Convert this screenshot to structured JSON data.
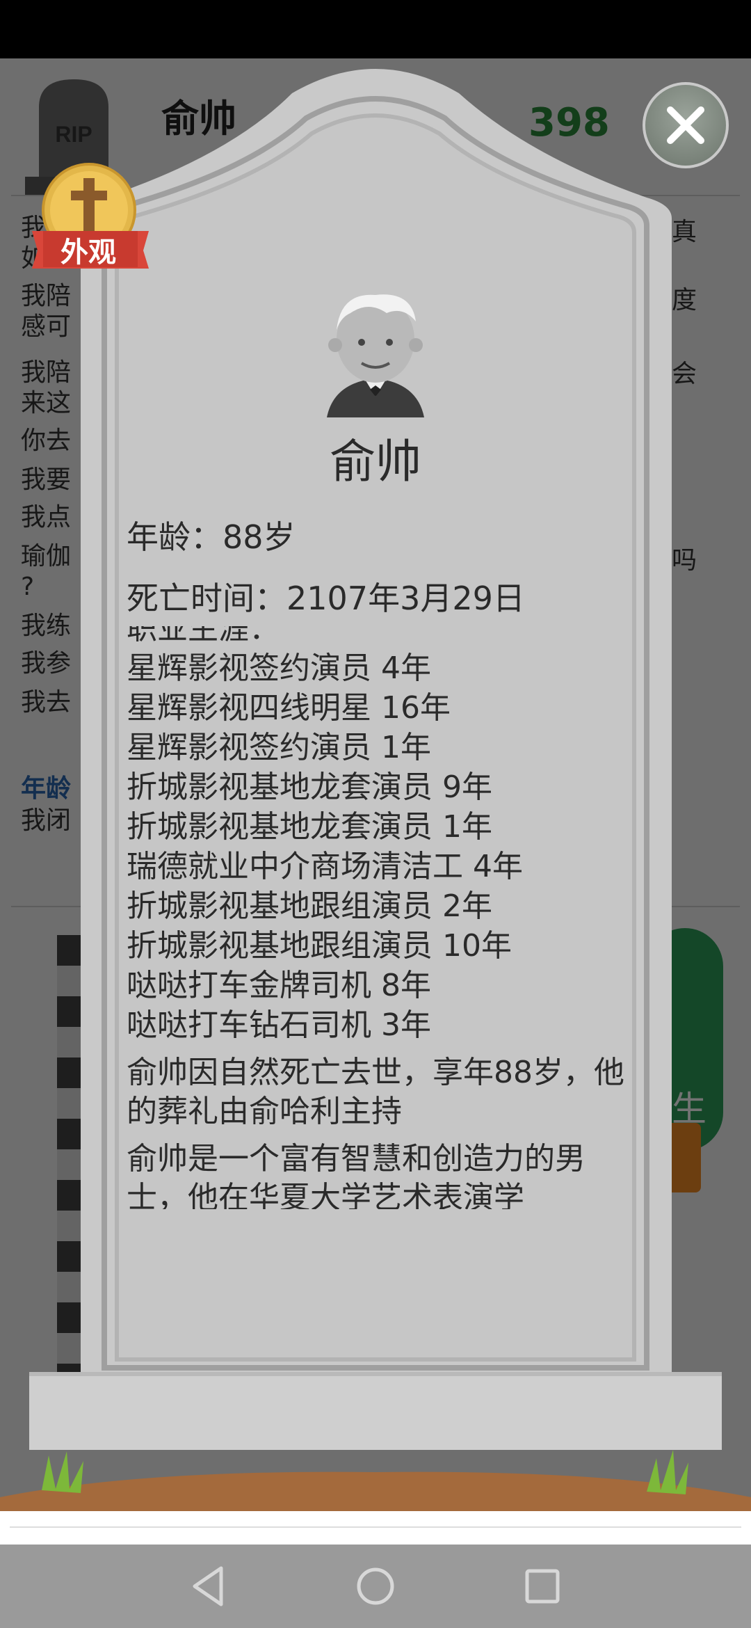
{
  "background": {
    "player_name": "俞帅",
    "money": "398",
    "log_lines": [
      "我",
      "如",
      "我陪",
      "感可",
      "我陪",
      "来这",
      "你去",
      "我要",
      "我点",
      "瑜伽",
      "?",
      "我练",
      "我参",
      "我去"
    ],
    "right_fragments": [
      "可真",
      "速度",
      "机会",
      "加吗"
    ],
    "age_label": "年龄",
    "age_line": "我闭",
    "green_button_fragment": "生"
  },
  "badge": {
    "label": "外观",
    "icon": "cross-icon"
  },
  "tombstone": {
    "name": "俞帅",
    "age_line": "年龄：88岁",
    "death_time_line": "死亡时间：2107年3月29日",
    "career_title": "职业生涯：",
    "career": [
      "星辉影视签约演员 4年",
      "星辉影视四线明星 16年",
      "星辉影视签约演员 1年",
      "折城影视基地龙套演员 9年",
      "折城影视基地龙套演员 1年",
      "瑞德就业中介商场清洁工 4年",
      "折城影视基地跟组演员 2年",
      "折城影视基地跟组演员 10年",
      "哒哒打车金牌司机 8年",
      "哒哒打车钻石司机 3年"
    ],
    "death_note": "俞帅因自然死亡去世，享年88岁，他的葬礼由俞哈利主持",
    "bio": "俞帅是一个富有智慧和创造力的男士，他在华夏大学艺术表演学"
  },
  "colors": {
    "stone": "#c8c8c8",
    "stone_edge": "#a9a9a9",
    "money_green": "#2a8a3a",
    "badge_red": "#d9463a",
    "badge_gold": "#e3b74a"
  }
}
